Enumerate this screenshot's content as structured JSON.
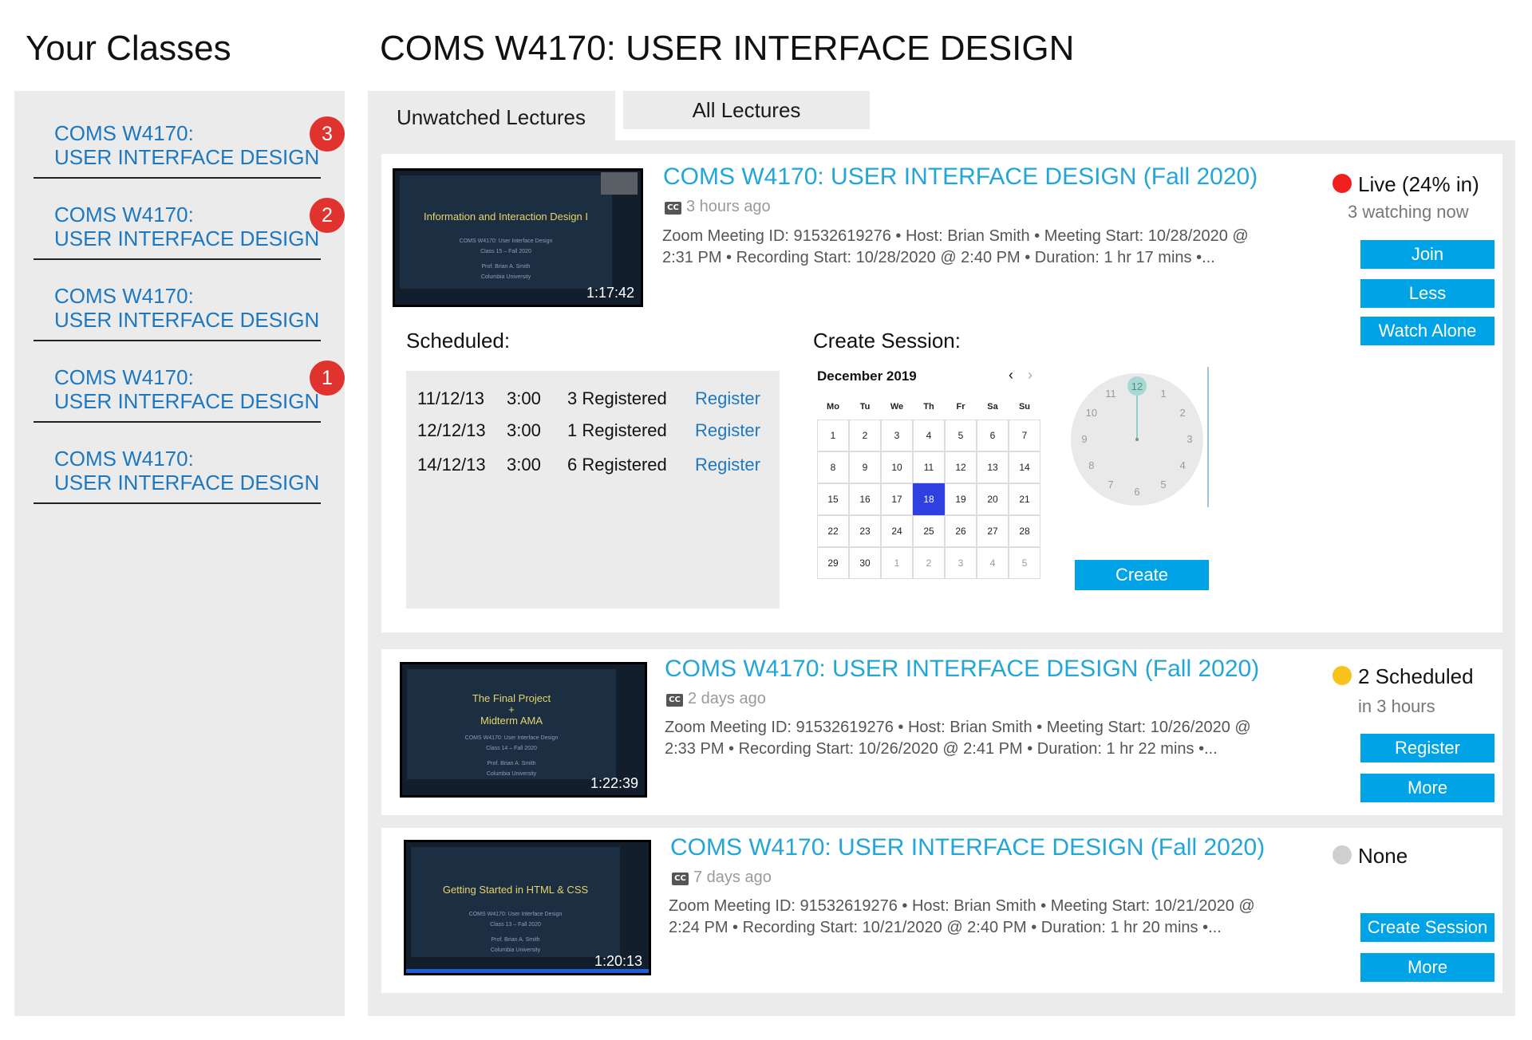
{
  "sidebar": {
    "title": "Your Classes",
    "items": [
      {
        "label": "COMS W4170:\nUSER INTERFACE DESIGN",
        "badge": "3"
      },
      {
        "label": "COMS W4170:\nUSER INTERFACE DESIGN",
        "badge": "2"
      },
      {
        "label": "COMS W4170:\nUSER INTERFACE DESIGN",
        "badge": ""
      },
      {
        "label": "COMS W4170:\nUSER INTERFACE DESIGN",
        "badge": "1"
      },
      {
        "label": "COMS W4170:\nUSER INTERFACE DESIGN",
        "badge": ""
      }
    ]
  },
  "header": {
    "course_title": "COMS W4170: USER INTERFACE DESIGN"
  },
  "tabs": {
    "unwatched": "Unwatched Lectures",
    "all": "All Lectures"
  },
  "lectures": [
    {
      "title": "COMS W4170: USER INTERFACE DESIGN (Fall 2020)",
      "ago": "3 hours ago",
      "meta_line1": "Zoom Meeting ID: 91532619276   • Host: Brian Smith   • Meeting Start: 10/28/2020 @",
      "meta_line2": "2:31 PM   • Recording Start: 10/28/2020 @ 2:40 PM   • Duration: 1 hr 17 mins   •...",
      "thumb_title": "Information and Interaction Design I",
      "thumb_sub": [
        "COMS W4170: User Interface Design",
        "Class 15 – Fall 2020",
        "Prof. Brian A. Smith",
        "Columbia University"
      ],
      "duration": "1:17:42",
      "status": "Live (24% in)",
      "status_color": "#f0201e",
      "substatus": "3 watching now",
      "buttons": [
        "Join",
        "Less",
        "Watch Alone"
      ]
    },
    {
      "title": "COMS W4170: USER INTERFACE DESIGN (Fall 2020)",
      "ago": "2 days ago",
      "meta_line1": "Zoom Meeting ID: 91532619276   • Host: Brian Smith   • Meeting Start: 10/26/2020 @",
      "meta_line2": "2:33 PM   • Recording Start: 10/26/2020 @ 2:41 PM   • Duration: 1 hr 22 mins   •...",
      "thumb_title": "The Final Project\n+\nMidterm AMA",
      "thumb_sub": [
        "COMS W4170: User Interface Design",
        "Class 14 – Fall 2020",
        "Prof. Brian A. Smith",
        "Columbia University"
      ],
      "duration": "1:22:39",
      "status": "2 Scheduled",
      "status_color": "#f8c21a",
      "substatus": "in 3 hours",
      "buttons": [
        "Register",
        "More"
      ]
    },
    {
      "title": "COMS W4170: USER INTERFACE DESIGN (Fall 2020)",
      "ago": "7 days ago",
      "meta_line1": "Zoom Meeting ID: 91532619276   • Host: Brian Smith   • Meeting Start: 10/21/2020 @",
      "meta_line2": "2:24 PM   • Recording Start: 10/21/2020 @ 2:40 PM   • Duration: 1 hr 20 mins   •...",
      "thumb_title": "Getting Started in HTML & CSS",
      "thumb_sub": [
        "COMS W4170: User Interface Design",
        "Class 13 – Fall 2020",
        "Prof. Brian A. Smith",
        "Columbia University"
      ],
      "duration": "1:20:13",
      "status": "None",
      "status_color": "#cfcfcf",
      "substatus": "",
      "buttons": [
        "Create Session",
        "More"
      ]
    }
  ],
  "scheduled": {
    "label": "Scheduled:",
    "rows": [
      {
        "date": "11/12/13",
        "time": "3:00",
        "registered": "3 Registered",
        "action": "Register"
      },
      {
        "date": "12/12/13",
        "time": "3:00",
        "registered": "1 Registered",
        "action": "Register"
      },
      {
        "date": "14/12/13",
        "time": "3:00",
        "registered": "6 Registered",
        "action": "Register"
      }
    ]
  },
  "create_session": {
    "label": "Create Session:",
    "calendar": {
      "month": "December 2019",
      "prev": "‹",
      "next": "›",
      "day_names": [
        "Mo",
        "Tu",
        "We",
        "Th",
        "Fr",
        "Sa",
        "Su"
      ],
      "weeks": [
        [
          "1",
          "2",
          "3",
          "4",
          "5",
          "6",
          "7"
        ],
        [
          "8",
          "9",
          "10",
          "11",
          "12",
          "13",
          "14"
        ],
        [
          "15",
          "16",
          "17",
          "18",
          "19",
          "20",
          "21"
        ],
        [
          "22",
          "23",
          "24",
          "25",
          "26",
          "27",
          "28"
        ],
        [
          "29",
          "30",
          "1",
          "2",
          "3",
          "4",
          "5"
        ]
      ],
      "selected": "18"
    },
    "clock_numbers": [
      "12",
      "1",
      "2",
      "3",
      "4",
      "5",
      "6",
      "7",
      "8",
      "9",
      "10",
      "11"
    ],
    "create_label": "Create"
  }
}
